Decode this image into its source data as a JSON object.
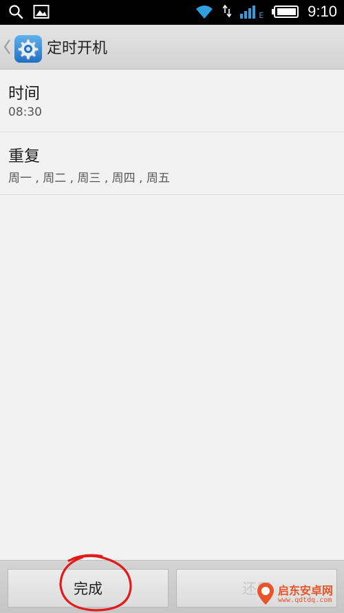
{
  "status_bar": {
    "time": "9:10",
    "network_type": "E",
    "icons": [
      "search-icon",
      "gallery-icon",
      "wifi-icon",
      "data-arrows-icon",
      "signal-icon",
      "battery-icon"
    ]
  },
  "header": {
    "title": "定时开机",
    "app_icon": "gear-icon"
  },
  "settings": [
    {
      "label": "时间",
      "value": "08:30"
    },
    {
      "label": "重复",
      "value": "周一 , 周二 , 周三 , 周四 , 周五"
    }
  ],
  "bottom_bar": {
    "done_label": "完成",
    "restore_label": "还原"
  },
  "watermark": {
    "name": "启东安卓网",
    "url": "www.qdtdq.com"
  },
  "colors": {
    "annotation_red": "#e31a1a",
    "accent_blue": "#2f86d8",
    "watermark_orange": "#e8552b"
  }
}
